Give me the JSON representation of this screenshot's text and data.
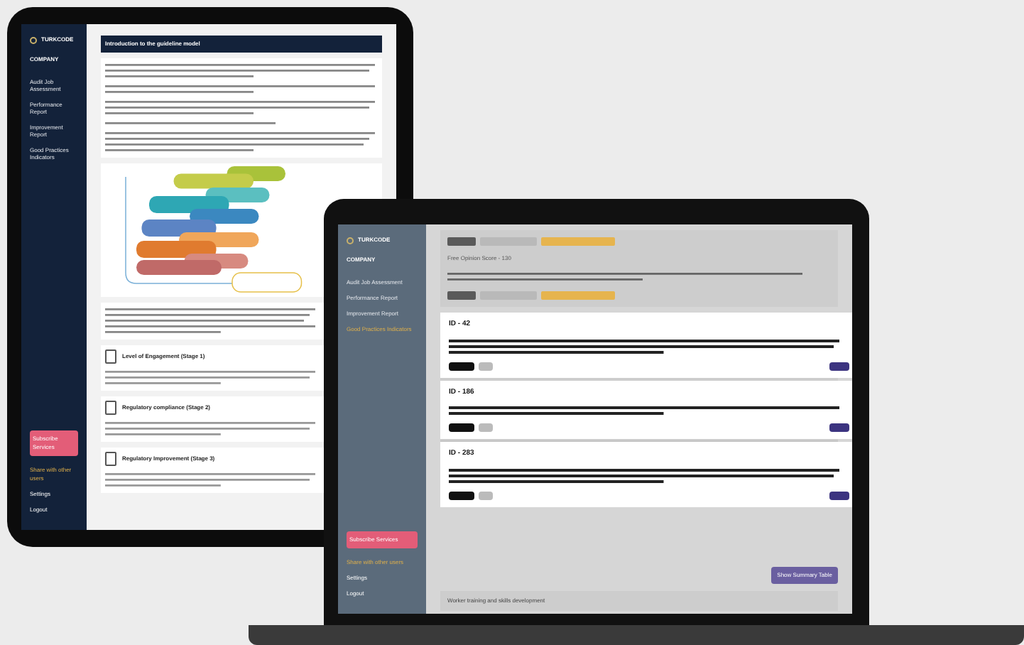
{
  "tablet": {
    "brand": "TURKCODE",
    "company": "COMPANY",
    "nav": [
      {
        "label": "Audit Job Assessment",
        "selected": false
      },
      {
        "label": "Performance Report",
        "selected": false
      },
      {
        "label": "Improvement Report",
        "selected": false
      },
      {
        "label": "Good Practices Indicators",
        "selected": false
      }
    ],
    "action_button": "Subscribe Services",
    "footer_links": [
      "Share with other users",
      "Settings",
      "Logout"
    ],
    "header": "Introduction to the guideline model",
    "sections": [
      {
        "title": "Level of Engagement (Stage 1)"
      },
      {
        "title": "Regulatory compliance (Stage 2)"
      },
      {
        "title": "Regulatory Improvement (Stage 3)"
      }
    ]
  },
  "laptop": {
    "brand": "TURKCODE",
    "company": "COMPANY",
    "nav": [
      {
        "label": "Audit Job Assessment",
        "selected": false
      },
      {
        "label": "Performance Report",
        "selected": false
      },
      {
        "label": "Improvement Report",
        "selected": false
      },
      {
        "label": "Good Practices Indicators",
        "selected": true
      }
    ],
    "action_button": "Subscribe Services",
    "footer_links": [
      "Share with other users",
      "Settings",
      "Logout"
    ],
    "score": "Free Opinion Score - 130",
    "cards": [
      {
        "id": "ID - 42"
      },
      {
        "id": "ID - 186"
      },
      {
        "id": "ID - 283"
      }
    ],
    "summary_button": "Show Summary Table",
    "bottom_item": "Worker training and skills development"
  }
}
